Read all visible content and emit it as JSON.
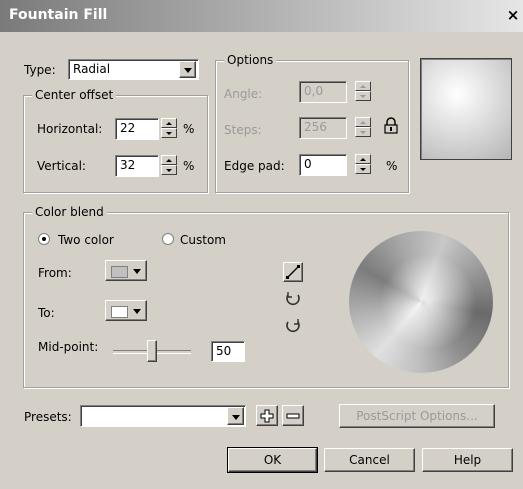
{
  "window": {
    "title": "Fountain Fill",
    "close_label": "×"
  },
  "type": {
    "label": "Type:",
    "value": "Radial"
  },
  "center_offset": {
    "title": "Center offset",
    "horizontal_label": "Horizontal:",
    "horizontal_value": "22",
    "vertical_label": "Vertical:",
    "vertical_value": "32",
    "unit": "%"
  },
  "options": {
    "title": "Options",
    "angle_label": "Angle:",
    "angle_value": "0,0",
    "steps_label": "Steps:",
    "steps_value": "256",
    "edge_pad_label": "Edge pad:",
    "edge_pad_value": "0",
    "unit": "%"
  },
  "color_blend": {
    "title": "Color blend",
    "two_color_label": "Two color",
    "custom_label": "Custom",
    "selected": "two_color",
    "from_label": "From:",
    "to_label": "To:",
    "midpoint_label": "Mid-point:",
    "midpoint_value": "50",
    "midpoint_fraction": 0.5
  },
  "presets": {
    "label": "Presets:",
    "value": ""
  },
  "buttons": {
    "postscript": "PostScript Options...",
    "ok": "OK",
    "cancel": "Cancel",
    "help": "Help"
  },
  "icons": [
    "lock-icon",
    "direct-blend-icon",
    "counterclockwise-blend-icon",
    "clockwise-blend-icon",
    "add-preset-icon",
    "remove-preset-icon"
  ]
}
